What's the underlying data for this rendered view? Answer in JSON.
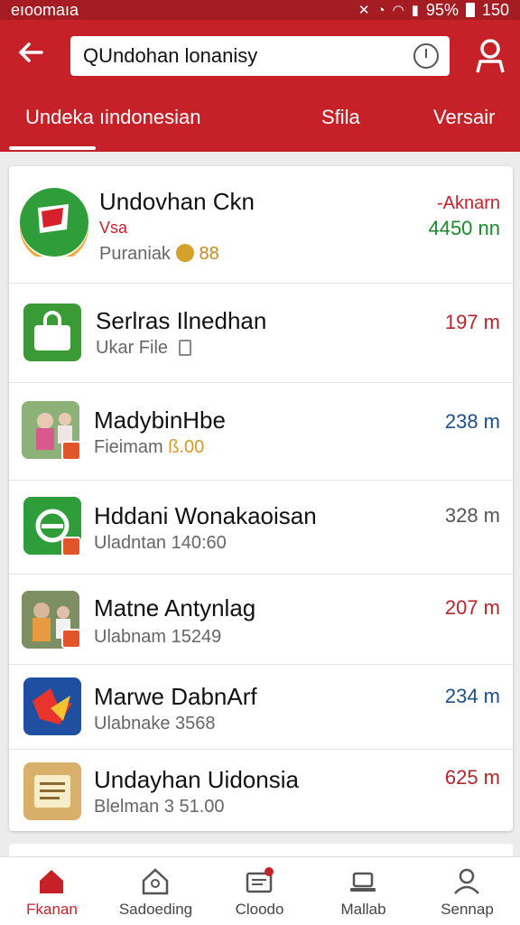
{
  "status_bar": {
    "left_text": "eıoomaıa",
    "battery": "95%",
    "time": "150"
  },
  "app_bar": {
    "search_value": "Undohan lonanisy",
    "tabs": [
      "Undeka ıindonesian",
      "Sfila",
      "Versair"
    ]
  },
  "list": [
    {
      "title": "Undovhan   Ckn",
      "tag": "Vsa",
      "subtitle": "Puraniak",
      "sub_extra": "88",
      "value_top": "-Aknarn",
      "value": "4450 nn",
      "value_color": "#1a8a2e",
      "top_color": "#c62128",
      "icon": "flag-app-icon"
    },
    {
      "title": "Serlras Ilnedhan",
      "subtitle": "Ukar File",
      "value": "197 m",
      "value_color": "#b4252a",
      "icon": "bag-app-icon"
    },
    {
      "title": "MadybinHbe",
      "subtitle": "Fieimam",
      "sub_extra": "ß.00",
      "value": "238 m",
      "value_color": "#1d4f8a",
      "icon": "photo-app-icon"
    },
    {
      "title": "Hddani Wonakaoisan",
      "subtitle": "Uladntan 140:60",
      "value": "328 m",
      "value_color": "#555555",
      "icon": "green-app-icon"
    },
    {
      "title": "Matne Antynlag",
      "subtitle": "Ulabnam 15249",
      "value": "207 m",
      "value_color": "#b4252a",
      "icon": "portrait-app-icon"
    },
    {
      "title": "Marwe DabnArf",
      "subtitle": "Ulabnake 3568",
      "value": "234 m",
      "value_color": "#1d4f8a",
      "icon": "star-app-icon"
    },
    {
      "title": "Undayhan Uidonsia",
      "subtitle": "Blelman 3 51.00",
      "value": "625 m",
      "value_color": "#b4252a",
      "icon": "document-app-icon"
    }
  ],
  "bottom_nav": [
    {
      "label": "Fkanan",
      "icon": "home-icon"
    },
    {
      "label": "Sadoeding",
      "icon": "house-search-icon"
    },
    {
      "label": "Cloodo",
      "icon": "inbox-icon"
    },
    {
      "label": "Mallab",
      "icon": "laptop-icon"
    },
    {
      "label": "Sennap",
      "icon": "person-icon"
    }
  ],
  "colors": {
    "brand_red": "#c62128",
    "status_red": "#a51d23"
  }
}
